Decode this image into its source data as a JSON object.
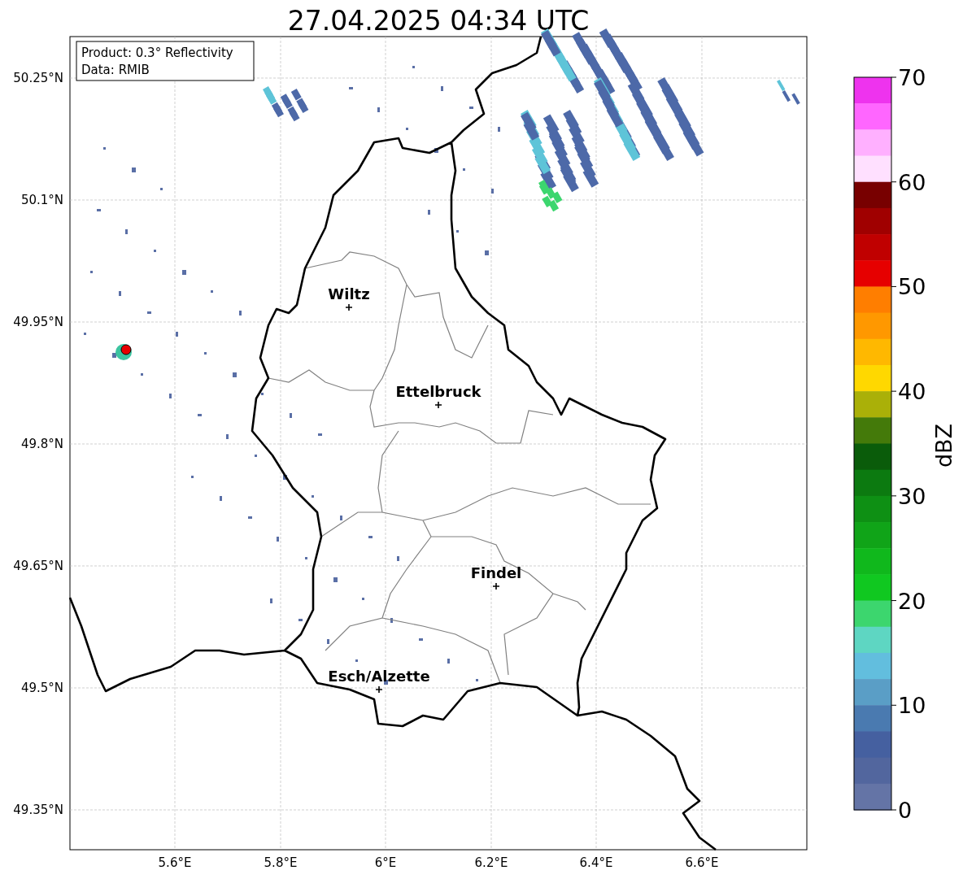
{
  "title": "27.04.2025 04:34 UTC",
  "legend": [
    "Product: 0.3° Reflectivity",
    "Data: RMIB"
  ],
  "cities": [
    {
      "name": "Wiltz"
    },
    {
      "name": "Ettelbruck"
    },
    {
      "name": "Findel"
    },
    {
      "name": "Esch/Alzette"
    }
  ],
  "x_ticks": [
    "5.6°E",
    "5.8°E",
    "6°E",
    "6.2°E",
    "6.4°E",
    "6.6°E"
  ],
  "y_ticks": [
    "50.25°N",
    "50.1°N",
    "49.95°N",
    "49.8°N",
    "49.65°N",
    "49.5°N",
    "49.35°N"
  ],
  "colorbar": {
    "label": "dBZ",
    "ticks": [
      "70",
      "60",
      "50",
      "40",
      "30",
      "20",
      "10",
      "0"
    ],
    "bins": [
      {
        "color": "#ee33ee"
      },
      {
        "color": "#ff66ff"
      },
      {
        "color": "#ffb0ff"
      },
      {
        "color": "#ffe0ff"
      },
      {
        "color": "#780000"
      },
      {
        "color": "#a00000"
      },
      {
        "color": "#c00000"
      },
      {
        "color": "#e60000"
      },
      {
        "color": "#ff7e00"
      },
      {
        "color": "#ff9800"
      },
      {
        "color": "#ffb800"
      },
      {
        "color": "#ffd800"
      },
      {
        "color": "#aab008"
      },
      {
        "color": "#447a0a"
      },
      {
        "color": "#0a5c0a"
      },
      {
        "color": "#0c7a10"
      },
      {
        "color": "#0e9014"
      },
      {
        "color": "#10a418"
      },
      {
        "color": "#10b81c"
      },
      {
        "color": "#10c820"
      },
      {
        "color": "#3cd66e"
      },
      {
        "color": "#5ed6c2"
      },
      {
        "color": "#62bede"
      },
      {
        "color": "#5a9ec6"
      },
      {
        "color": "#4a7ab0"
      },
      {
        "color": "#4560a0"
      },
      {
        "color": "#52669e"
      },
      {
        "color": "#6474a6"
      }
    ]
  }
}
